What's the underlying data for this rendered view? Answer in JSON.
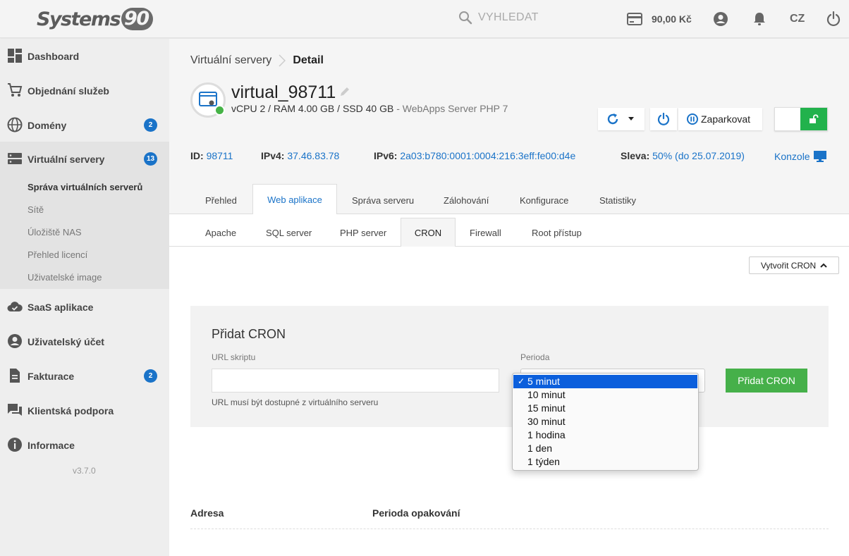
{
  "app": {
    "logo_text": "Systems",
    "logo_num": "90"
  },
  "topbar": {
    "search_placeholder": "VYHLEDAT",
    "credit": "90,00 Kč",
    "lang": "CZ"
  },
  "sidebar": {
    "items": [
      {
        "label": "Dashboard",
        "icon": "dashboard-icon"
      },
      {
        "label": "Objednání služeb",
        "icon": "cart-icon"
      },
      {
        "label": "Domény",
        "icon": "globe-icon",
        "badge": "2"
      },
      {
        "label": "Virtuální servery",
        "icon": "server-icon",
        "badge": "13"
      },
      {
        "label": "SaaS aplikace",
        "icon": "cloud-check-icon"
      },
      {
        "label": "Uživatelský účet",
        "icon": "user-icon"
      },
      {
        "label": "Fakturace",
        "icon": "document-icon",
        "badge": "2"
      },
      {
        "label": "Klientská podpora",
        "icon": "chat-icon"
      },
      {
        "label": "Informace",
        "icon": "info-icon"
      }
    ],
    "sub_items": [
      "Správa virtuálních serverů",
      "Sítě",
      "Úložiště NAS",
      "Přehled licencí",
      "Uživatelské image"
    ],
    "version": "v3.7.0"
  },
  "breadcrumb": {
    "parent": "Virtuální servery",
    "current": "Detail"
  },
  "server": {
    "name": "virtual_98711",
    "spec": "vCPU 2 / RAM 4.00 GB / SSD 40 GB",
    "spec_extra": " - WebApps Server PHP 7",
    "status_color": "#46b347"
  },
  "actions": {
    "park_label": "Zaparkovat"
  },
  "info": {
    "id_label": "ID:",
    "id_value": "98711",
    "ipv4_label": "IPv4:",
    "ipv4_value": "37.46.83.78",
    "ipv6_label": "IPv6:",
    "ipv6_value": "2a03:b780:0001:0004:216:3eff:fe00:d4e",
    "discount_label": "Sleva:",
    "discount_value": "50% (do 25.07.2019)",
    "console_label": "Konzole"
  },
  "tabs": [
    "Přehled",
    "Web aplikace",
    "Správa serveru",
    "Zálohování",
    "Konfigurace",
    "Statistiky"
  ],
  "subtabs": [
    "Apache",
    "SQL server",
    "PHP server",
    "CRON",
    "Firewall",
    "Root přístup"
  ],
  "cron": {
    "create_label": "Vytvořit CRON",
    "panel_title": "Přidat CRON",
    "url_label": "URL skriptu",
    "url_value": "",
    "url_hint": "URL musí být dostupné z virtuálního serveru",
    "period_label": "Perioda",
    "period_options": [
      "5 minut",
      "10 minut",
      "15 minut",
      "30 minut",
      "1 hodina",
      "1 den",
      "1 týden"
    ],
    "period_selected": "5 minut",
    "add_label": "Přidat CRON"
  },
  "table": {
    "col_address": "Adresa",
    "col_period": "Perioda opakování"
  },
  "colors": {
    "accent": "#1a73c8",
    "green": "#46b04a",
    "selection": "#0b5fdc"
  }
}
